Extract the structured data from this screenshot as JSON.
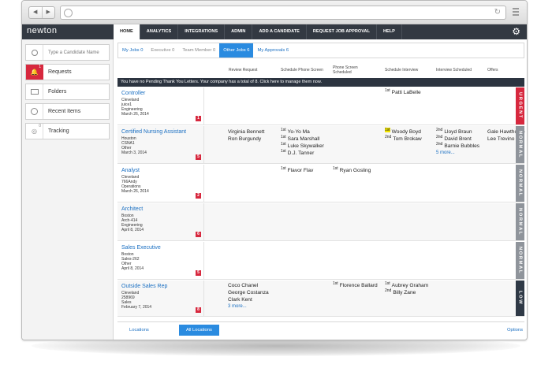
{
  "app": {
    "logo": "newton"
  },
  "topnav": [
    "HOME",
    "ANALYTICS",
    "INTEGRATIONS",
    "ADMIN",
    "ADD A CANDIDATE",
    "REQUEST JOB APPROVAL",
    "HELP"
  ],
  "sidebar": {
    "search_placeholder": "Type a Candidate Name",
    "items": [
      {
        "label": "Requests",
        "badge": "1"
      },
      {
        "label": "Folders"
      },
      {
        "label": "Recent Items"
      },
      {
        "label": "Tracking",
        "badge": "0"
      }
    ]
  },
  "subtabs": [
    "My Jobs 0",
    "Executive 0",
    "Team Member 0",
    "Other Jobs 6",
    "My Approvals 6"
  ],
  "columns": {
    "review_request": "Review Request",
    "schedule_phone_screen": "Schedule Phone Screen",
    "phone_screen_scheduled_1": "Phone Screen",
    "phone_screen_scheduled_2": "Scheduled",
    "schedule_interview": "Schedule Interview",
    "interview_scheduled": "Interview Scheduled",
    "offers": "Offers"
  },
  "banner": {
    "text": "You have no Pending Thank You Letters. Your company has a total of 8.",
    "link": "Click here to manage them now."
  },
  "jobs": [
    {
      "title": "Controller",
      "meta": [
        "Cleveland",
        "juice1",
        "Engineering",
        "March 26, 2014"
      ],
      "count": "1",
      "priority": "URGENT"
    },
    {
      "title": "Certified Nursing Assistant",
      "meta": [
        "Houston",
        "CSNA1",
        "Other",
        "March 3, 2014"
      ],
      "count": "5",
      "priority": "NORMAL"
    },
    {
      "title": "Analyst",
      "meta": [
        "Cleveland",
        "766Andy",
        "Operations",
        "March 26, 2014"
      ],
      "count": "2",
      "priority": "NORMAL"
    },
    {
      "title": "Architect",
      "meta": [
        "Boston",
        "Arch-414",
        "Engineering",
        "April 8, 2014"
      ],
      "count": "6",
      "priority": "NORMAL"
    },
    {
      "title": "Sales Executive",
      "meta": [
        "Boston",
        "Sales-262",
        "Other",
        "April 8, 2014"
      ],
      "count": "5",
      "priority": "NORMAL"
    },
    {
      "title": "Outside Sales Rep",
      "meta": [
        "Cleveland",
        "258969",
        "Sales",
        "February 7, 2014"
      ],
      "count": "8",
      "priority": "LOW"
    }
  ],
  "cells": {
    "r0_si": "Patti LaBelle",
    "r1_rr": [
      "Virginia Bennett",
      "Ron Burgundy"
    ],
    "r1_sps": [
      "Yo-Yo Ma",
      "Sara Marshall",
      "Luke Skywalker",
      "D.J. Tanner"
    ],
    "r1_si": [
      "Woody Boyd",
      "Tom Brokaw"
    ],
    "r1_is": [
      "Lloyd Braun",
      "David Brent",
      "Barnie Bubbles"
    ],
    "r1_is_more": "5 more...",
    "r1_of": [
      "Gale Hawthorne",
      "Lee Trevino"
    ],
    "r2_sps": "Flavor Flav",
    "r2_pss": "Ryan Gosling",
    "r5_rr": [
      "Coco Chanel",
      "George Costanza",
      "Clark Kent"
    ],
    "r5_rr_more": "3 more...",
    "r5_pss": "Florence Ballard",
    "r5_si": [
      "Aubrey Graham",
      "Billy Zane"
    ]
  },
  "ranks": {
    "first": "1st",
    "second": "2nd"
  },
  "footer": {
    "tabs": [
      "Locations",
      "All Locations"
    ],
    "options": "Options"
  }
}
